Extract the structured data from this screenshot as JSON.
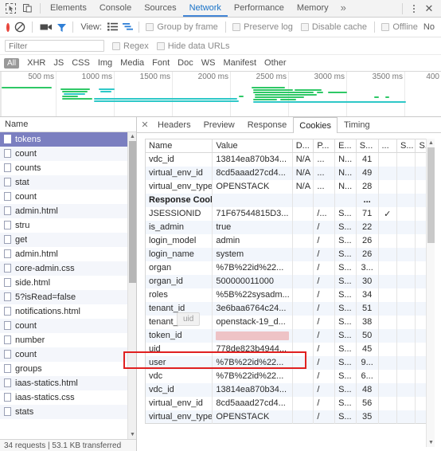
{
  "tabstrip": {
    "icons": [
      {
        "name": "inspect-element-icon",
        "glyph": "⬉"
      },
      {
        "name": "device-toolbar-icon",
        "glyph": "❐"
      }
    ],
    "tabs": [
      {
        "label": "Elements",
        "active": false
      },
      {
        "label": "Console",
        "active": false
      },
      {
        "label": "Sources",
        "active": false
      },
      {
        "label": "Network",
        "active": true
      },
      {
        "label": "Performance",
        "active": false
      },
      {
        "label": "Memory",
        "active": false
      }
    ],
    "more_label": "»",
    "menu_name": "more-options-icon",
    "close_label": "✕"
  },
  "network_toolbar": {
    "record_title": "record-button",
    "clear_title": "clear-button",
    "camera_title": "capture-screenshots-button",
    "filter_title": "filter-button",
    "view_label": "View:",
    "checkboxes": [
      {
        "label": "Group by frame",
        "checked": false
      },
      {
        "label": "Preserve log",
        "checked": false
      },
      {
        "label": "Disable cache",
        "checked": false
      },
      {
        "label": "Offline",
        "checked": false
      }
    ],
    "throttle_label": "No"
  },
  "filter_row": {
    "placeholder": "Filter",
    "value": "",
    "regex_label": "Regex",
    "hide_data_urls_label": "Hide data URLs"
  },
  "type_filters": {
    "all_label": "All",
    "types": [
      "XHR",
      "JS",
      "CSS",
      "Img",
      "Media",
      "Font",
      "Doc",
      "WS",
      "Manifest",
      "Other"
    ]
  },
  "overview": {
    "ticks": [
      "500 ms",
      "1000 ms",
      "1500 ms",
      "2000 ms",
      "2500 ms",
      "3000 ms",
      "3500 ms",
      "400"
    ],
    "bar_color": "#2ec866",
    "bar_color_alt": "#2ec8c8"
  },
  "requests": {
    "header": "Name",
    "items": [
      {
        "name": "tokens",
        "selected": true
      },
      {
        "name": "count",
        "selected": false
      },
      {
        "name": "counts",
        "selected": false
      },
      {
        "name": "stat",
        "selected": false
      },
      {
        "name": "count",
        "selected": false
      },
      {
        "name": "admin.html",
        "selected": false
      },
      {
        "name": "stru",
        "selected": false
      },
      {
        "name": "get",
        "selected": false
      },
      {
        "name": "admin.html",
        "selected": false
      },
      {
        "name": "core-admin.css",
        "selected": false
      },
      {
        "name": "side.html",
        "selected": false
      },
      {
        "name": "5?isRead=false",
        "selected": false
      },
      {
        "name": "notifications.html",
        "selected": false
      },
      {
        "name": "count",
        "selected": false
      },
      {
        "name": "number",
        "selected": false
      },
      {
        "name": "count",
        "selected": false
      },
      {
        "name": "groups",
        "selected": false
      },
      {
        "name": "iaas-statics.html",
        "selected": false
      },
      {
        "name": "iaas-statics.css",
        "selected": false
      },
      {
        "name": "stats",
        "selected": false
      }
    ],
    "status": "34 requests  |  53.1 KB transferred"
  },
  "detail": {
    "close_label": "✕",
    "tabs": [
      {
        "label": "Headers",
        "active": false
      },
      {
        "label": "Preview",
        "active": false
      },
      {
        "label": "Response",
        "active": false
      },
      {
        "label": "Cookies",
        "active": true
      },
      {
        "label": "Timing",
        "active": false
      }
    ]
  },
  "cookies_table": {
    "columns": [
      "Name",
      "Value",
      "D...",
      "P...",
      "E...",
      "S...",
      "...",
      "S...",
      "S..."
    ],
    "rows": [
      {
        "name": "vdc_id",
        "value": "13814ea870b34...",
        "d": "N/A",
        "p": "...",
        "e": "N...",
        "s": "41",
        "http": "",
        "s2": "",
        "s3": "",
        "section": false,
        "redacted": false
      },
      {
        "name": "virtual_env_id",
        "value": "8cd5aaad27cd4...",
        "d": "N/A",
        "p": "...",
        "e": "N...",
        "s": "49",
        "http": "",
        "s2": "",
        "s3": "",
        "section": false,
        "redacted": false
      },
      {
        "name": "virtual_env_type",
        "value": "OPENSTACK",
        "d": "N/A",
        "p": "...",
        "e": "N...",
        "s": "28",
        "http": "",
        "s2": "",
        "s3": "",
        "section": false,
        "redacted": false
      },
      {
        "name": "Response Cookies",
        "value": "",
        "d": "",
        "p": "",
        "e": "",
        "s": "...",
        "http": "",
        "s2": "",
        "s3": "",
        "section": true,
        "redacted": false
      },
      {
        "name": "JSESSIONID",
        "value": "71F67544815D3...",
        "d": "",
        "p": "/...",
        "e": "S...",
        "s": "71",
        "http": "✓",
        "s2": "",
        "s3": "",
        "section": false,
        "redacted": false
      },
      {
        "name": "is_admin",
        "value": "true",
        "d": "",
        "p": "/",
        "e": "S...",
        "s": "22",
        "http": "",
        "s2": "",
        "s3": "",
        "section": false,
        "redacted": false
      },
      {
        "name": "login_model",
        "value": "admin",
        "d": "",
        "p": "/",
        "e": "S...",
        "s": "26",
        "http": "",
        "s2": "",
        "s3": "",
        "section": false,
        "redacted": false
      },
      {
        "name": "login_name",
        "value": "system",
        "d": "",
        "p": "/",
        "e": "S...",
        "s": "26",
        "http": "",
        "s2": "",
        "s3": "",
        "section": false,
        "redacted": false
      },
      {
        "name": "organ",
        "value": "%7B%22id%22...",
        "d": "",
        "p": "/",
        "e": "S...",
        "s": "3...",
        "http": "",
        "s2": "",
        "s3": "",
        "section": false,
        "redacted": false
      },
      {
        "name": "organ_id",
        "value": "500000011000",
        "d": "",
        "p": "/",
        "e": "S...",
        "s": "30",
        "http": "",
        "s2": "",
        "s3": "",
        "section": false,
        "redacted": false
      },
      {
        "name": "roles",
        "value": "%5B%22sysadm...",
        "d": "",
        "p": "/",
        "e": "S...",
        "s": "34",
        "http": "",
        "s2": "",
        "s3": "",
        "section": false,
        "redacted": false
      },
      {
        "name": "tenant_id",
        "value": "3e6baa6764c24...",
        "d": "",
        "p": "/",
        "e": "S...",
        "s": "51",
        "http": "",
        "s2": "",
        "s3": "",
        "section": false,
        "redacted": false
      },
      {
        "name": "tenant_name",
        "value": "openstack-19_d...",
        "d": "",
        "p": "/",
        "e": "S...",
        "s": "38",
        "http": "",
        "s2": "",
        "s3": "",
        "section": false,
        "redacted": false
      },
      {
        "name": "token_id",
        "value": "",
        "d": "",
        "p": "/",
        "e": "S...",
        "s": "50",
        "http": "",
        "s2": "",
        "s3": "",
        "section": false,
        "redacted": true
      },
      {
        "name": "uid",
        "value": "778de823b4944...",
        "d": "",
        "p": "/",
        "e": "S...",
        "s": "45",
        "http": "",
        "s2": "",
        "s3": "",
        "section": false,
        "redacted": false
      },
      {
        "name": "user",
        "value": "%7B%22id%22...",
        "d": "",
        "p": "/",
        "e": "S...",
        "s": "9...",
        "http": "",
        "s2": "",
        "s3": "",
        "section": false,
        "redacted": false
      },
      {
        "name": "vdc",
        "value": "%7B%22id%22...",
        "d": "",
        "p": "/",
        "e": "S...",
        "s": "6...",
        "http": "",
        "s2": "",
        "s3": "",
        "section": false,
        "redacted": false
      },
      {
        "name": "vdc_id",
        "value": "13814ea870b34...",
        "d": "",
        "p": "/",
        "e": "S...",
        "s": "48",
        "http": "",
        "s2": "",
        "s3": "",
        "section": false,
        "redacted": false
      },
      {
        "name": "virtual_env_id",
        "value": "8cd5aaad27cd4...",
        "d": "",
        "p": "/",
        "e": "S...",
        "s": "56",
        "http": "",
        "s2": "",
        "s3": "",
        "section": false,
        "redacted": false
      },
      {
        "name": "virtual_env_type",
        "value": "OPENSTACK",
        "d": "",
        "p": "/",
        "e": "S...",
        "s": "35",
        "http": "",
        "s2": "",
        "s3": "",
        "section": false,
        "redacted": false
      }
    ]
  },
  "annotation": {
    "highlight_color": "#e02020",
    "tooltip_text": "uid"
  }
}
